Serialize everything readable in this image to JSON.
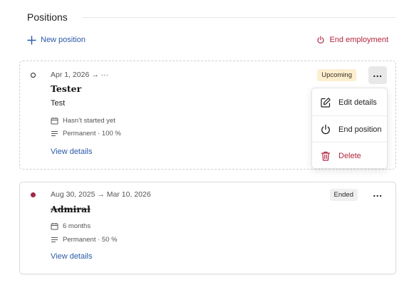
{
  "section": {
    "title": "Positions"
  },
  "actions": {
    "new_position": "New position",
    "end_employment": "End employment"
  },
  "positions": [
    {
      "date_range": "Apr 1, 2026 → ···",
      "title": "Tester",
      "subtitle": "Test",
      "duration": "Hasn’t started yet",
      "contract": "Permanent · 100 %",
      "status": "Upcoming",
      "link": "View details"
    },
    {
      "date_range": "Aug 30, 2025 → Mar 10, 2026",
      "title": "Admiral",
      "duration": "6 months",
      "contract": "Permanent · 50 %",
      "status": "Ended",
      "link": "View details"
    }
  ],
  "menu": {
    "edit": "Edit details",
    "end": "End position",
    "delete": "Delete"
  },
  "colors": {
    "link": "#2b5aa8",
    "danger": "#b3263e",
    "upcoming_badge": "#fbefcf",
    "ended_badge": "#f0f0f0",
    "ended_dot": "#a32745"
  },
  "icons": [
    "plus-icon",
    "power-icon",
    "more-icon",
    "calendar-icon",
    "lines-icon",
    "edit-icon",
    "trash-icon"
  ]
}
